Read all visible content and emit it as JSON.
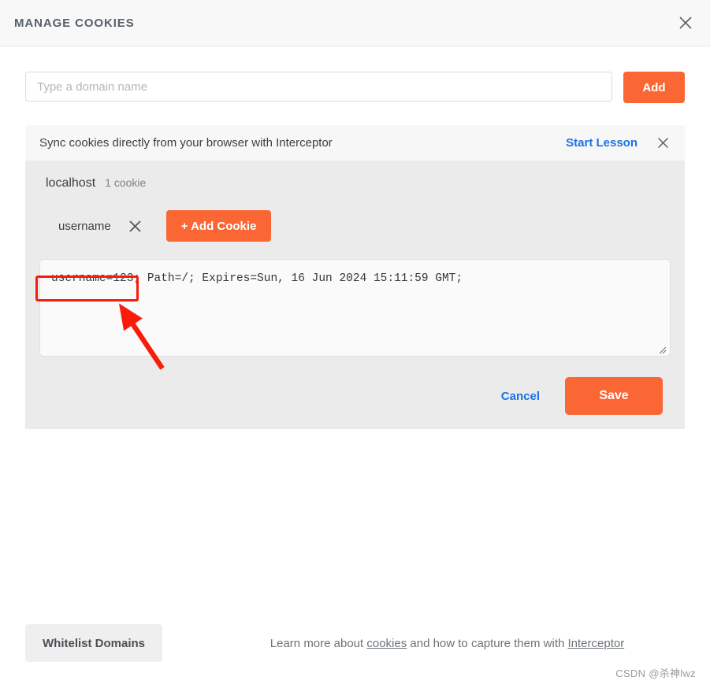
{
  "header": {
    "title": "MANAGE COOKIES",
    "close_icon": "close-icon"
  },
  "domain_add": {
    "placeholder": "Type a domain name",
    "value": "",
    "add_label": "Add"
  },
  "sync_banner": {
    "text": "Sync cookies directly from your browser with Interceptor",
    "link_label": "Start Lesson",
    "close_icon": "close-icon"
  },
  "cookie_panel": {
    "domain": "localhost",
    "count_label": "1 cookie",
    "cookie_name": "username",
    "delete_icon": "close-icon",
    "add_cookie_label": "+ Add Cookie",
    "cookie_value": "username=123; Path=/; Expires=Sun, 16 Jun 2024 15:11:59 GMT;",
    "cancel_label": "Cancel",
    "save_label": "Save"
  },
  "footer": {
    "whitelist_label": "Whitelist Domains",
    "note_prefix": "Learn more about ",
    "note_link1": "cookies",
    "note_middle": " and how to capture them with ",
    "note_link2": "Interceptor",
    "watermark": "CSDN @杀神lwz"
  },
  "colors": {
    "accent_orange": "#fa6735",
    "link_blue": "#1a73e8",
    "panel_grey": "#ebebeb",
    "banner_grey": "#f7f7f7",
    "annotation_red": "#f91c0c"
  }
}
